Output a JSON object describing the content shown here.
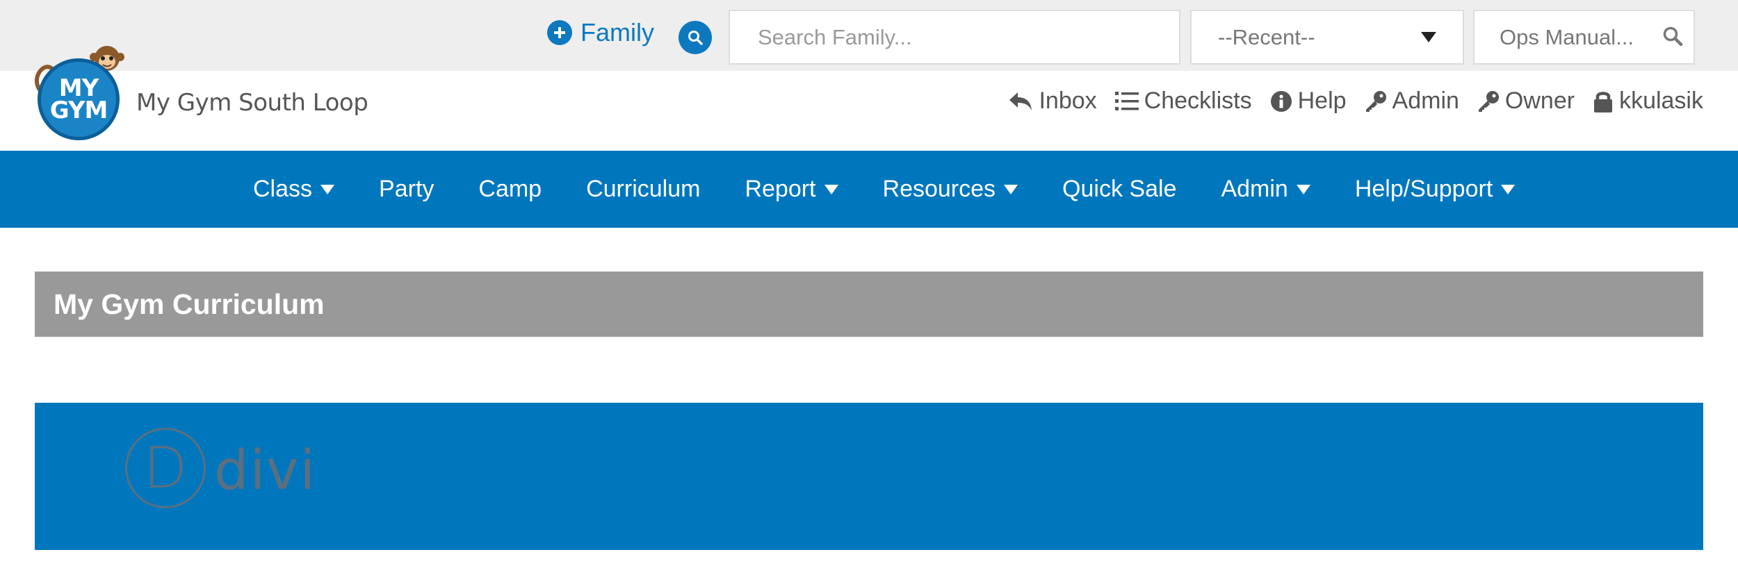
{
  "topbar": {
    "family_label": "Family",
    "search_family_placeholder": "Search Family...",
    "recent_selected": "--Recent--",
    "ops_manual_placeholder": "Ops Manual..."
  },
  "header": {
    "logo_text_line1": "MY",
    "logo_text_line2": "GYM",
    "gym_name": "My Gym South Loop",
    "links": {
      "inbox": "Inbox",
      "checklists": "Checklists",
      "help": "Help",
      "admin": "Admin",
      "owner": "Owner",
      "user": "kkulasik"
    }
  },
  "nav": {
    "items": [
      {
        "label": "Class",
        "dropdown": true
      },
      {
        "label": "Party",
        "dropdown": false
      },
      {
        "label": "Camp",
        "dropdown": false
      },
      {
        "label": "Curriculum",
        "dropdown": false
      },
      {
        "label": "Report",
        "dropdown": true
      },
      {
        "label": "Resources",
        "dropdown": true
      },
      {
        "label": "Quick Sale",
        "dropdown": false
      },
      {
        "label": "Admin",
        "dropdown": true
      },
      {
        "label": "Help/Support",
        "dropdown": true
      }
    ]
  },
  "page": {
    "title": "My Gym Curriculum"
  },
  "banner": {
    "logo_letter": "D",
    "logo_word": "divi"
  },
  "colors": {
    "brand_blue": "#0077bd",
    "title_bar_grey": "#999999",
    "top_bar_grey": "#eeeeee"
  }
}
